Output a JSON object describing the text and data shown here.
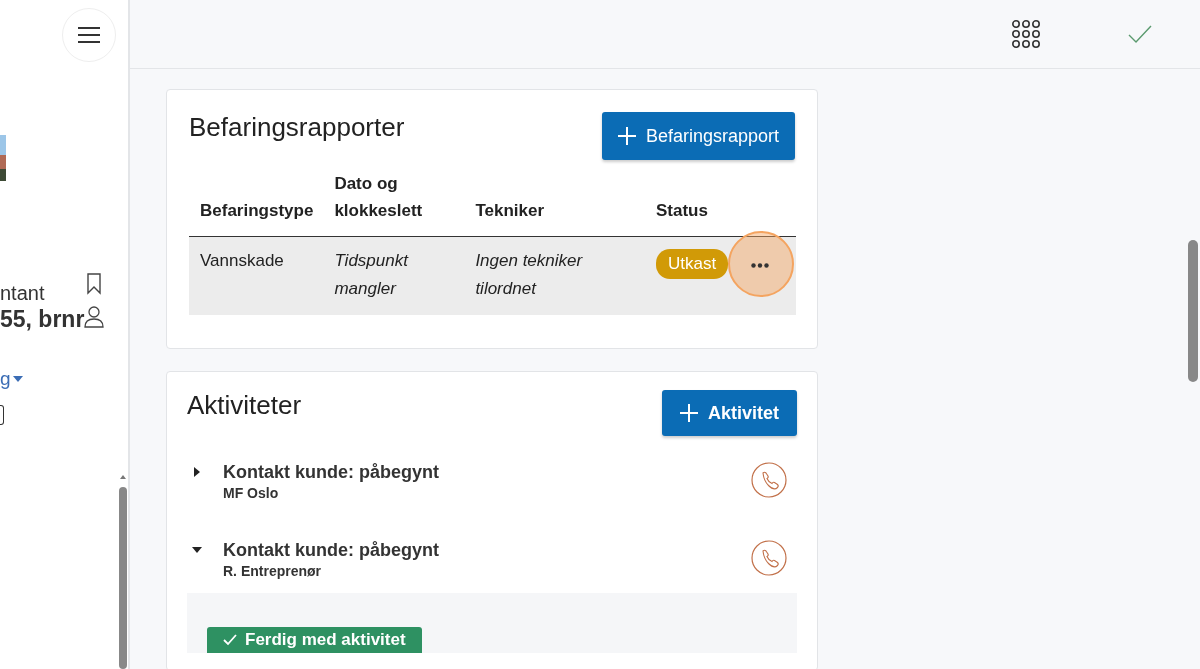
{
  "sidebar": {
    "line_1": "ntant",
    "line_2": "55, brnr",
    "link": "g"
  },
  "reports": {
    "title": "Befaringsrapporter",
    "add_button": "Befaringsrapport",
    "columns": [
      "Befaringstype",
      "Dato og klokkeslett",
      "Tekniker",
      "Status"
    ],
    "rows": [
      {
        "type": "Vannskade",
        "date": "Tidspunkt mangler",
        "technician": "Ingen tekniker tilordnet",
        "status": "Utkast"
      }
    ]
  },
  "activities": {
    "title": "Aktiviteter",
    "add_button": "Aktivitet",
    "items": [
      {
        "title": "Kontakt kunde: påbegynt",
        "subtitle": "MF Oslo",
        "expanded": false
      },
      {
        "title": "Kontakt kunde: påbegynt",
        "subtitle": "R. Entreprenør",
        "expanded": true,
        "action": "Ferdig med aktivitet"
      }
    ]
  }
}
